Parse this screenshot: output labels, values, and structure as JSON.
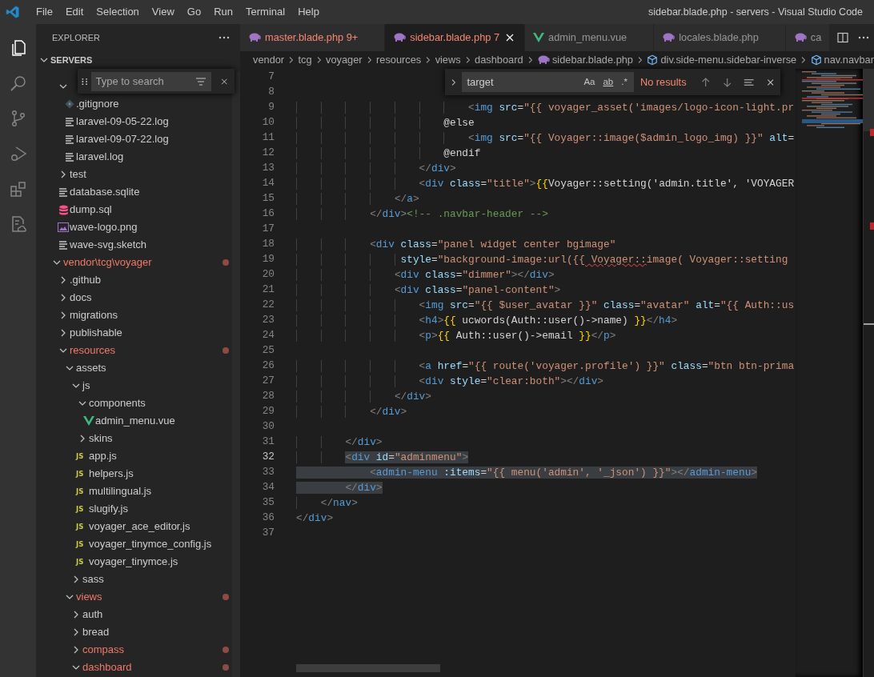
{
  "window": {
    "title": "sidebar.blade.php - servers - Visual Studio Code"
  },
  "menu": [
    "File",
    "Edit",
    "Selection",
    "View",
    "Go",
    "Run",
    "Terminal",
    "Help"
  ],
  "activity_bar": [
    {
      "kind": "files",
      "selected": true
    },
    {
      "kind": "search",
      "selected": false
    },
    {
      "kind": "scm",
      "selected": false
    },
    {
      "kind": "debug",
      "selected": false
    },
    {
      "kind": "extensions",
      "selected": false
    },
    {
      "kind": "remote",
      "selected": false
    }
  ],
  "sidebar": {
    "title": "EXPLORER",
    "section": {
      "label": "SERVERS",
      "expanded": true
    },
    "search": {
      "placeholder": "Type to search"
    },
    "tree": [
      {
        "kind": "scrolled",
        "children": [
          {
            "kind": "folder",
            "expanded": true,
            "children": [
              {
                "kind": "git",
                "label": ".gitignore",
                "modified": false
              },
              {
                "kind": "text",
                "label": "laravel-09-05-22.log",
                "modified": false
              },
              {
                "kind": "text",
                "label": "laravel-09-07-22.log",
                "modified": false
              },
              {
                "kind": "text",
                "label": "laravel.log",
                "modified": false
              }
            ]
          },
          {
            "kind": "folder",
            "label": "test",
            "expanded": false,
            "modified": false
          },
          {
            "kind": "text",
            "label": "database.sqlite",
            "modified": false
          },
          {
            "kind": "database",
            "label": "dump.sql",
            "modified": false
          },
          {
            "kind": "image",
            "label": "wave-logo.png",
            "modified": false
          },
          {
            "kind": "text",
            "label": "wave-svg.sketch",
            "modified": false
          }
        ]
      },
      {
        "kind": "folder",
        "label": "vendor\\tcg\\voyager",
        "expanded": true,
        "modified": true,
        "children": [
          {
            "kind": "folder",
            "label": ".github",
            "expanded": false,
            "modified": false
          },
          {
            "kind": "folder",
            "label": "docs",
            "expanded": false,
            "modified": false
          },
          {
            "kind": "folder",
            "label": "migrations",
            "expanded": false,
            "modified": false
          },
          {
            "kind": "folder",
            "label": "publishable",
            "expanded": false,
            "modified": false
          },
          {
            "kind": "folder",
            "label": "resources",
            "expanded": true,
            "modified": true,
            "children": [
              {
                "kind": "folder",
                "label": "assets",
                "expanded": true,
                "modified": false,
                "children": [
                  {
                    "kind": "folder",
                    "label": "js",
                    "expanded": true,
                    "modified": false,
                    "children": [
                      {
                        "kind": "folder",
                        "label": "components",
                        "expanded": true,
                        "modified": false,
                        "children": [
                          {
                            "kind": "vue",
                            "label": "admin_menu.vue",
                            "modified": false
                          }
                        ]
                      },
                      {
                        "kind": "folder",
                        "label": "skins",
                        "expanded": false,
                        "modified": false
                      },
                      {
                        "kind": "js",
                        "icon_text": "JS",
                        "label": "app.js",
                        "modified": false
                      },
                      {
                        "kind": "js",
                        "icon_text": "JS",
                        "label": "helpers.js",
                        "modified": false
                      },
                      {
                        "kind": "js",
                        "icon_text": "JS",
                        "label": "multilingual.js",
                        "modified": false
                      },
                      {
                        "kind": "js",
                        "icon_text": "JS",
                        "label": "slugify.js",
                        "modified": false
                      },
                      {
                        "kind": "js",
                        "icon_text": "JS",
                        "label": "voyager_ace_editor.js",
                        "modified": false
                      },
                      {
                        "kind": "js",
                        "icon_text": "JS",
                        "label": "voyager_tinymce_config.js",
                        "modified": false
                      },
                      {
                        "kind": "js",
                        "icon_text": "JS",
                        "label": "voyager_tinymce.js",
                        "modified": false
                      }
                    ]
                  },
                  {
                    "kind": "folder",
                    "label": "sass",
                    "expanded": false,
                    "modified": false
                  }
                ]
              },
              {
                "kind": "folder",
                "label": "views",
                "expanded": true,
                "modified": true,
                "children": [
                  {
                    "kind": "folder",
                    "label": "auth",
                    "expanded": false,
                    "modified": false
                  },
                  {
                    "kind": "folder",
                    "label": "bread",
                    "expanded": false,
                    "modified": false
                  },
                  {
                    "kind": "folder",
                    "label": "compass",
                    "expanded": false,
                    "modified": true
                  },
                  {
                    "kind": "folder",
                    "label": "dashboard",
                    "expanded": true,
                    "modified": true
                  }
                ]
              }
            ]
          }
        ]
      }
    ]
  },
  "tabs": [
    {
      "kind": "php",
      "label": "master.blade.php",
      "problems": "9+",
      "errors": true,
      "selected": false
    },
    {
      "kind": "php",
      "label": "sidebar.blade.php",
      "problems": "7",
      "errors": true,
      "selected": true
    },
    {
      "kind": "vue",
      "label": "admin_menu.vue",
      "errors": false,
      "selected": false
    },
    {
      "kind": "php",
      "label": "locales.blade.php",
      "errors": false,
      "selected": false
    },
    {
      "kind": "php",
      "label": "ca",
      "errors": false,
      "selected": false
    }
  ],
  "breadcrumbs": [
    {
      "kind": "folder",
      "label": "vendor"
    },
    {
      "kind": "folder",
      "label": "tcg"
    },
    {
      "kind": "folder",
      "label": "voyager"
    },
    {
      "kind": "folder",
      "label": "resources"
    },
    {
      "kind": "folder",
      "label": "views"
    },
    {
      "kind": "folder",
      "label": "dashboard"
    },
    {
      "kind": "php",
      "label": "sidebar.blade.php"
    },
    {
      "kind": "symbol",
      "label": "div.side-menu.sidebar-inverse"
    },
    {
      "kind": "symbol",
      "label": "nav.navbar"
    }
  ],
  "find": {
    "value": "target",
    "options": [
      {
        "kind": "case",
        "label": "Aa",
        "on": false
      },
      {
        "kind": "word",
        "label": "ab",
        "on": false
      },
      {
        "kind": "regex",
        "label": ".*",
        "on": false
      }
    ],
    "result": "No results"
  },
  "lines": [
    {
      "number": "7",
      "current": false
    },
    {
      "number": "8",
      "current": false
    },
    {
      "number": "9",
      "tokens": [
        {
          "text": "                            <",
          "kind": "bracket"
        },
        {
          "text": "img",
          "kind": "tag"
        },
        {
          "text": " src",
          "kind": "attr"
        },
        {
          "text": "=",
          "kind": "plain"
        },
        {
          "text": "\"{{ voyager_asset('images/logo-icon-light.pr",
          "kind": "string"
        }
      ],
      "selected": false,
      "current": false
    },
    {
      "number": "10",
      "tokens": [
        {
          "text": "                        @else",
          "kind": "plain"
        }
      ],
      "selected": false,
      "current": false
    },
    {
      "number": "11",
      "tokens": [
        {
          "text": "                            <",
          "kind": "bracket"
        },
        {
          "text": "img",
          "kind": "tag"
        },
        {
          "text": " src",
          "kind": "attr"
        },
        {
          "text": "=",
          "kind": "plain"
        },
        {
          "text": "\"{{ Voyager::image($admin_logo_img) }}\"",
          "kind": "string"
        },
        {
          "text": " alt",
          "kind": "attr"
        },
        {
          "text": "=",
          "kind": "plain"
        }
      ],
      "selected": false,
      "current": false
    },
    {
      "number": "12",
      "tokens": [
        {
          "text": "                        @endif",
          "kind": "plain"
        }
      ],
      "selected": false,
      "current": false
    },
    {
      "number": "13",
      "tokens": [
        {
          "text": "                    </",
          "kind": "bracket"
        },
        {
          "text": "div",
          "kind": "tag"
        },
        {
          "text": ">",
          "kind": "bracket"
        }
      ],
      "selected": false,
      "current": false
    },
    {
      "number": "14",
      "tokens": [
        {
          "text": "                    <",
          "kind": "bracket"
        },
        {
          "text": "div",
          "kind": "tag"
        },
        {
          "text": " class",
          "kind": "attr"
        },
        {
          "text": "=",
          "kind": "plain"
        },
        {
          "text": "\"title\"",
          "kind": "string"
        },
        {
          "text": ">",
          "kind": "bracket"
        },
        {
          "text": "{{",
          "kind": "braces"
        },
        {
          "text": "Voyager::setting('admin.title', 'VOYAGER",
          "kind": "plain"
        }
      ],
      "selected": false,
      "current": false
    },
    {
      "number": "15",
      "tokens": [
        {
          "text": "                </",
          "kind": "bracket"
        },
        {
          "text": "a",
          "kind": "tag"
        },
        {
          "text": ">",
          "kind": "bracket"
        }
      ],
      "selected": false,
      "current": false
    },
    {
      "number": "16",
      "tokens": [
        {
          "text": "            </",
          "kind": "bracket"
        },
        {
          "text": "div",
          "kind": "tag"
        },
        {
          "text": ">",
          "kind": "bracket"
        },
        {
          "text": "<!-- .navbar-header -->",
          "kind": "comment"
        }
      ],
      "selected": false,
      "current": false
    },
    {
      "number": "17",
      "current": false
    },
    {
      "number": "18",
      "tokens": [
        {
          "text": "            <",
          "kind": "bracket"
        },
        {
          "text": "div",
          "kind": "tag"
        },
        {
          "text": " class",
          "kind": "attr"
        },
        {
          "text": "=",
          "kind": "plain"
        },
        {
          "text": "\"panel widget center bgimage\"",
          "kind": "string"
        }
      ],
      "selected": false,
      "current": false
    },
    {
      "number": "19",
      "tokens": [
        {
          "text": "                 style",
          "kind": "attr"
        },
        {
          "text": "=",
          "kind": "plain"
        },
        {
          "text": "\"background-image:url({{",
          "kind": "string"
        },
        {
          "text": " Voyager::",
          "kind": "squiggle"
        },
        {
          "text": "image( Voyager::setting",
          "kind": "string"
        }
      ],
      "selected": false,
      "current": false
    },
    {
      "number": "20",
      "tokens": [
        {
          "text": "                <",
          "kind": "bracket"
        },
        {
          "text": "div",
          "kind": "tag"
        },
        {
          "text": " class",
          "kind": "attr"
        },
        {
          "text": "=",
          "kind": "plain"
        },
        {
          "text": "\"dimmer\"",
          "kind": "string"
        },
        {
          "text": "></",
          "kind": "bracket"
        },
        {
          "text": "div",
          "kind": "tag"
        },
        {
          "text": ">",
          "kind": "bracket"
        }
      ],
      "selected": false,
      "current": false
    },
    {
      "number": "21",
      "tokens": [
        {
          "text": "                <",
          "kind": "bracket"
        },
        {
          "text": "div",
          "kind": "tag"
        },
        {
          "text": " class",
          "kind": "attr"
        },
        {
          "text": "=",
          "kind": "plain"
        },
        {
          "text": "\"panel-content\"",
          "kind": "string"
        },
        {
          "text": ">",
          "kind": "bracket"
        }
      ],
      "selected": false,
      "current": false
    },
    {
      "number": "22",
      "tokens": [
        {
          "text": "                    <",
          "kind": "bracket"
        },
        {
          "text": "img",
          "kind": "tag"
        },
        {
          "text": " src",
          "kind": "attr"
        },
        {
          "text": "=",
          "kind": "plain"
        },
        {
          "text": "\"{{ $user_avatar }}\"",
          "kind": "string"
        },
        {
          "text": " class",
          "kind": "attr"
        },
        {
          "text": "=",
          "kind": "plain"
        },
        {
          "text": "\"avatar\"",
          "kind": "string"
        },
        {
          "text": " alt",
          "kind": "attr"
        },
        {
          "text": "=",
          "kind": "plain"
        },
        {
          "text": "\"{{ Auth::us",
          "kind": "string"
        }
      ],
      "selected": false,
      "current": false
    },
    {
      "number": "23",
      "tokens": [
        {
          "text": "                    <",
          "kind": "bracket"
        },
        {
          "text": "h4",
          "kind": "tag"
        },
        {
          "text": ">",
          "kind": "bracket"
        },
        {
          "text": "{{",
          "kind": "braces"
        },
        {
          "text": " ucwords(Auth::user()->name) ",
          "kind": "plain"
        },
        {
          "text": "}}",
          "kind": "braces"
        },
        {
          "text": "</",
          "kind": "bracket"
        },
        {
          "text": "h4",
          "kind": "tag"
        },
        {
          "text": ">",
          "kind": "bracket"
        }
      ],
      "selected": false,
      "current": false
    },
    {
      "number": "24",
      "tokens": [
        {
          "text": "                    <",
          "kind": "bracket"
        },
        {
          "text": "p",
          "kind": "tag"
        },
        {
          "text": ">",
          "kind": "bracket"
        },
        {
          "text": "{{",
          "kind": "braces"
        },
        {
          "text": " Auth::user()->email ",
          "kind": "plain"
        },
        {
          "text": "}}",
          "kind": "braces"
        },
        {
          "text": "</",
          "kind": "bracket"
        },
        {
          "text": "p",
          "kind": "tag"
        },
        {
          "text": ">",
          "kind": "bracket"
        }
      ],
      "selected": false,
      "current": false
    },
    {
      "number": "25",
      "current": false
    },
    {
      "number": "26",
      "tokens": [
        {
          "text": "                    <",
          "kind": "bracket"
        },
        {
          "text": "a",
          "kind": "tag"
        },
        {
          "text": " href",
          "kind": "attr"
        },
        {
          "text": "=",
          "kind": "plain"
        },
        {
          "text": "\"{{ route('voyager.profile') }}\"",
          "kind": "string"
        },
        {
          "text": " class",
          "kind": "attr"
        },
        {
          "text": "=",
          "kind": "plain"
        },
        {
          "text": "\"btn btn-prima",
          "kind": "string"
        }
      ],
      "selected": false,
      "current": false
    },
    {
      "number": "27",
      "tokens": [
        {
          "text": "                    <",
          "kind": "bracket"
        },
        {
          "text": "div",
          "kind": "tag"
        },
        {
          "text": " style",
          "kind": "attr"
        },
        {
          "text": "=",
          "kind": "plain"
        },
        {
          "text": "\"clear:both\"",
          "kind": "string"
        },
        {
          "text": "></",
          "kind": "bracket"
        },
        {
          "text": "div",
          "kind": "tag"
        },
        {
          "text": ">",
          "kind": "bracket"
        }
      ],
      "selected": false,
      "current": false
    },
    {
      "number": "28",
      "tokens": [
        {
          "text": "                </",
          "kind": "bracket"
        },
        {
          "text": "div",
          "kind": "tag"
        },
        {
          "text": ">",
          "kind": "bracket"
        }
      ],
      "selected": false,
      "current": false
    },
    {
      "number": "29",
      "tokens": [
        {
          "text": "            </",
          "kind": "bracket"
        },
        {
          "text": "div",
          "kind": "tag"
        },
        {
          "text": ">",
          "kind": "bracket"
        }
      ],
      "selected": false,
      "current": false
    },
    {
      "number": "30",
      "current": false
    },
    {
      "number": "31",
      "tokens": [
        {
          "text": "        </",
          "kind": "bracket"
        },
        {
          "text": "div",
          "kind": "tag"
        },
        {
          "text": ">",
          "kind": "bracket"
        }
      ],
      "selected": false,
      "current": false
    },
    {
      "number": "32",
      "tokens": [
        {
          "text": "        <",
          "kind": "bracket"
        },
        {
          "text": "div",
          "kind": "tag"
        },
        {
          "text": " id",
          "kind": "attr"
        },
        {
          "text": "=",
          "kind": "plain"
        },
        {
          "text": "\"adminmenu\"",
          "kind": "string"
        },
        {
          "text": ">",
          "kind": "bracket"
        }
      ],
      "selected": true,
      "current": true
    },
    {
      "number": "33",
      "tokens": [
        {
          "text": "            <",
          "kind": "bracket"
        },
        {
          "text": "admin-menu",
          "kind": "tag"
        },
        {
          "text": " :items",
          "kind": "attr"
        },
        {
          "text": "=",
          "kind": "plain"
        },
        {
          "text": "\"{{ menu('admin', '_json') }}\"",
          "kind": "string"
        },
        {
          "text": "></",
          "kind": "bracket"
        },
        {
          "text": "admin-menu",
          "kind": "tag"
        },
        {
          "text": ">",
          "kind": "bracket"
        }
      ],
      "selected": true,
      "current": false
    },
    {
      "number": "34",
      "tokens": [
        {
          "text": "        </",
          "kind": "bracket"
        },
        {
          "text": "div",
          "kind": "tag"
        },
        {
          "text": ">",
          "kind": "bracket"
        }
      ],
      "selected": true,
      "current": false
    },
    {
      "number": "35",
      "tokens": [
        {
          "text": "    </",
          "kind": "bracket"
        },
        {
          "text": "nav",
          "kind": "tag"
        },
        {
          "text": ">",
          "kind": "bracket"
        }
      ],
      "selected": false,
      "current": false
    },
    {
      "number": "36",
      "tokens": [
        {
          "text": "</",
          "kind": "bracket"
        },
        {
          "text": "div",
          "kind": "tag"
        },
        {
          "text": ">",
          "kind": "bracket"
        }
      ],
      "selected": false,
      "current": false
    },
    {
      "number": "37",
      "current": false
    }
  ]
}
